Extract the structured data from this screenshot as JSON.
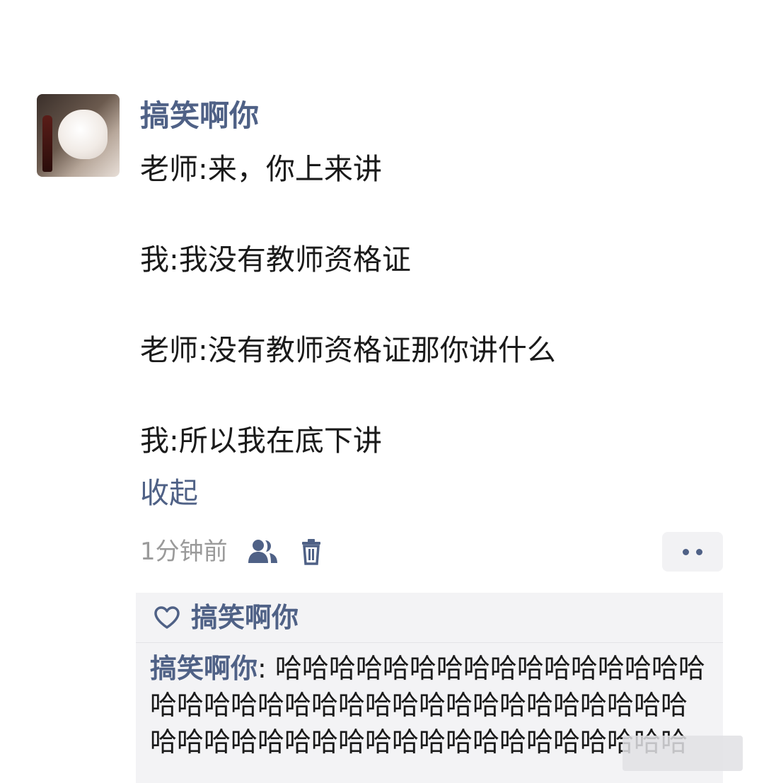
{
  "post": {
    "username": "搞笑啊你",
    "lines": [
      "老师:来，你上来讲",
      "我:我没有教师资格证",
      "老师:没有教师资格证那你讲什么",
      "我:所以我在底下讲"
    ],
    "collapse_label": "收起",
    "timestamp": "1分钟前"
  },
  "likes": {
    "names": "搞笑啊你"
  },
  "comments": [
    {
      "author": "搞笑啊你",
      "separator": ": ",
      "text": "哈哈哈哈哈哈哈哈哈哈哈哈哈哈哈哈哈哈哈哈哈哈哈哈哈哈哈哈哈哈哈哈哈哈哈哈哈哈哈哈哈哈哈哈哈哈哈哈哈哈哈哈哈哈哈哈"
    }
  ],
  "icons": {
    "friends": "friends-visibility-icon",
    "trash": "trash-icon",
    "more": "more-dots-icon",
    "heart": "heart-outline-icon"
  },
  "colors": {
    "link": "#4f6186",
    "meta": "#9a9a9a",
    "panel": "#f3f3f5"
  }
}
